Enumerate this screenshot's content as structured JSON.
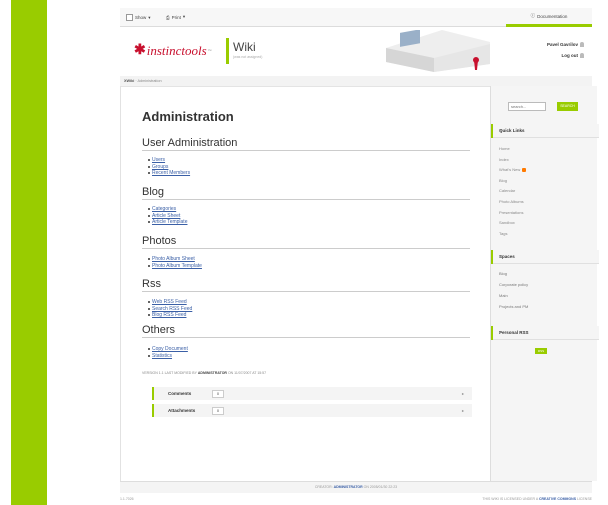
{
  "toolbar": {
    "show_label": "Show",
    "print_label": "Print",
    "documentation_label": "Documentation"
  },
  "header": {
    "logo_text": "instinctools",
    "wiki_title": "Wiki",
    "wiki_subtitle": "(was not assigned)",
    "user_name": "Pavel Gavrilov",
    "logout_label": "Log out"
  },
  "breadcrumb": {
    "root": "XWiki",
    "current": "Administration"
  },
  "main": {
    "page_title": "Administration",
    "sections": [
      {
        "title": "User Administration",
        "links": [
          "Users",
          "Groups",
          "Recent Members"
        ]
      },
      {
        "title": "Blog",
        "links": [
          "Categories",
          "Article Sheet",
          "Article Template"
        ]
      },
      {
        "title": "Photos",
        "links": [
          "Photo Album Sheet",
          "Photo Album Template"
        ]
      },
      {
        "title": "Rss",
        "links": [
          "Web RSS Feed",
          "Search RSS Feed",
          "Blog RSS Feed"
        ]
      },
      {
        "title": "Others",
        "links": [
          "Copy Document",
          "Statistics"
        ]
      }
    ],
    "version_text": "VERSION 1.1 LAST MODIFIED BY",
    "version_author": "ADMINISTRATOR",
    "version_date": "ON 11/07/2007 AT 15:57",
    "comments_label": "Comments",
    "comments_count": "0",
    "attachments_label": "Attachments",
    "attachments_count": "0"
  },
  "sidebar": {
    "search_placeholder": "search...",
    "search_button": "SEARCH",
    "quick_links_title": "Quick Links",
    "quick_links": [
      "Home",
      "Index",
      "What's New",
      "Blog",
      "Calendar",
      "Photo Albums",
      "Presentations",
      "Sandbox",
      "Tags"
    ],
    "spaces_title": "Spaces",
    "spaces": [
      "Blog",
      "Corporate policy",
      "Main",
      "Projects and PM"
    ],
    "personal_rss_title": "Personal RSS",
    "rss_button": "RSS"
  },
  "footer": {
    "created_text": "CREATOR:",
    "creator": "ADMINISTRATOR",
    "created_date": "ON 2005/01/30 22:23",
    "version": "1.1.7026",
    "license_text": "THIS WIKI IS LICENSED UNDER A",
    "license_link": "CREATIVE COMMONS",
    "license_suffix": "LICENSE"
  },
  "colors": {
    "accent": "#99cc00",
    "brand": "#c8102e",
    "link": "#3a5fa6"
  }
}
